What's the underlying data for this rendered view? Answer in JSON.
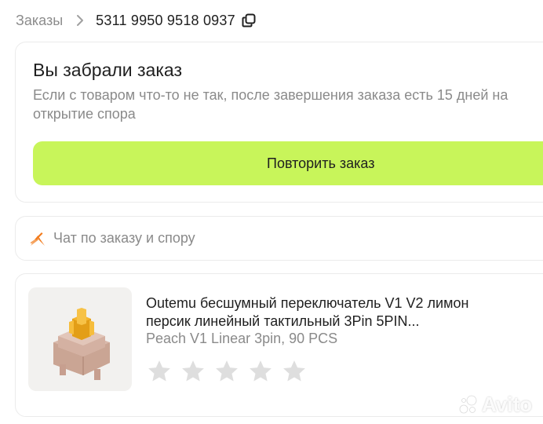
{
  "breadcrumb": {
    "parent_label": "Заказы",
    "order_number": "5311 9950 9518 0937",
    "separator_icon": "chevron-right-icon",
    "copy_icon": "copy-icon"
  },
  "status_card": {
    "title": "Вы забрали заказ",
    "description": "Если с товаром что-то не так, после завершения заказа есть 15 дней на открытие спора",
    "repeat_button_label": "Повторить заказ",
    "accent_color": "#c8f55a"
  },
  "chat": {
    "label": "Чат по заказу и спору",
    "icon": "chat-logo-icon"
  },
  "product": {
    "title": "Outemu бесшумный переключатель V1 V2 лимон персик линейный тактильный 3Pin 5PIN...",
    "variant": "Peach V1 Linear 3pin, 90 PCS",
    "image_icon": "keyboard-switch-image",
    "rating": {
      "max_stars": 5,
      "value": 0
    }
  },
  "watermark": {
    "brand": "Avito"
  }
}
